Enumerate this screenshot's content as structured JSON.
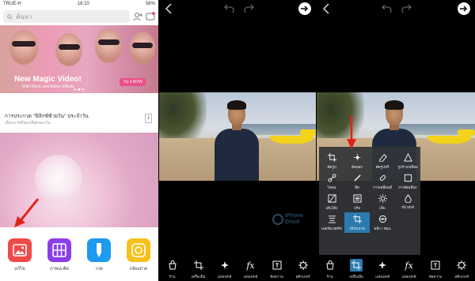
{
  "status": {
    "carrier": "TRUE-H",
    "time": "16:10",
    "battery": "58%"
  },
  "store": {
    "search_placeholder": "ค้นหา",
    "banner": {
      "title": "New Magic Video!",
      "subtitle": "With Music and Action Effects",
      "button": "Try it NOW"
    },
    "card": {
      "title": "การประกวด \"ฟิลิกซ์ซ้ายวัน\"  ประจำวัน",
      "subtitle": "เลือกภาพที่ชอบที่สุดของวัน",
      "badge": "1"
    },
    "dock": [
      {
        "label": "แก้ไข",
        "icon": "photo-edit-icon",
        "color": "#ef4b4b"
      },
      {
        "label": "ภาพปะติด",
        "icon": "collage-grid-icon",
        "color": "#8b3ee8"
      },
      {
        "label": "วาด",
        "icon": "draw-icon",
        "color": "#1d9bf0"
      },
      {
        "label": "กล้องถ่าย",
        "icon": "camera-icon",
        "color": "#f4c21b"
      }
    ]
  },
  "editor": {
    "watermark": [
      "iPhone",
      "Droid"
    ],
    "bottom_bar": [
      {
        "label": "ร้าน",
        "icon": "shop-bag-icon"
      },
      {
        "label": "เครื่องมือ",
        "icon": "crop-tool-icon"
      },
      {
        "label": "เอฟเฟกต์",
        "icon": "sparkle-icon"
      },
      {
        "label": "เอฟเฟกต์",
        "icon": "fx-icon"
      },
      {
        "label": "ข้อความ",
        "icon": "text-box-icon"
      },
      {
        "label": "สติกเกอร์",
        "icon": "sticker-gear-icon"
      }
    ],
    "tools_menu": [
      {
        "label": "ตัดรูป",
        "icon": "crop-icon"
      },
      {
        "label": "ตัดออก",
        "icon": "free-crop-icon"
      },
      {
        "label": "ตัดรูปฟรี",
        "icon": "eraser-icon"
      },
      {
        "label": "รูปร่างเหลือม",
        "icon": "shape-icon"
      },
      {
        "label": "โคลน",
        "icon": "clone-icon"
      },
      {
        "label": "ยืด",
        "icon": "stretch-icon"
      },
      {
        "label": "การเคลื่อนที่",
        "icon": "motion-icon"
      },
      {
        "label": "การคัดเลือก",
        "icon": "selection-icon"
      },
      {
        "label": "เส้นโค้ง",
        "icon": "curves-icon"
      },
      {
        "label": "ปรับ",
        "icon": "adjust-icon"
      },
      {
        "label": "เพิ่ม",
        "icon": "enhance-icon"
      },
      {
        "label": "Tilt Shift",
        "icon": "tilt-shift-icon"
      },
      {
        "label": "เพอร์สเปคทีฟ",
        "icon": "perspective-icon"
      },
      {
        "label": "ปรับขนาด",
        "icon": "resize-icon"
      },
      {
        "label": "พลิก / หมุน",
        "icon": "flip-rotate-icon"
      }
    ]
  }
}
